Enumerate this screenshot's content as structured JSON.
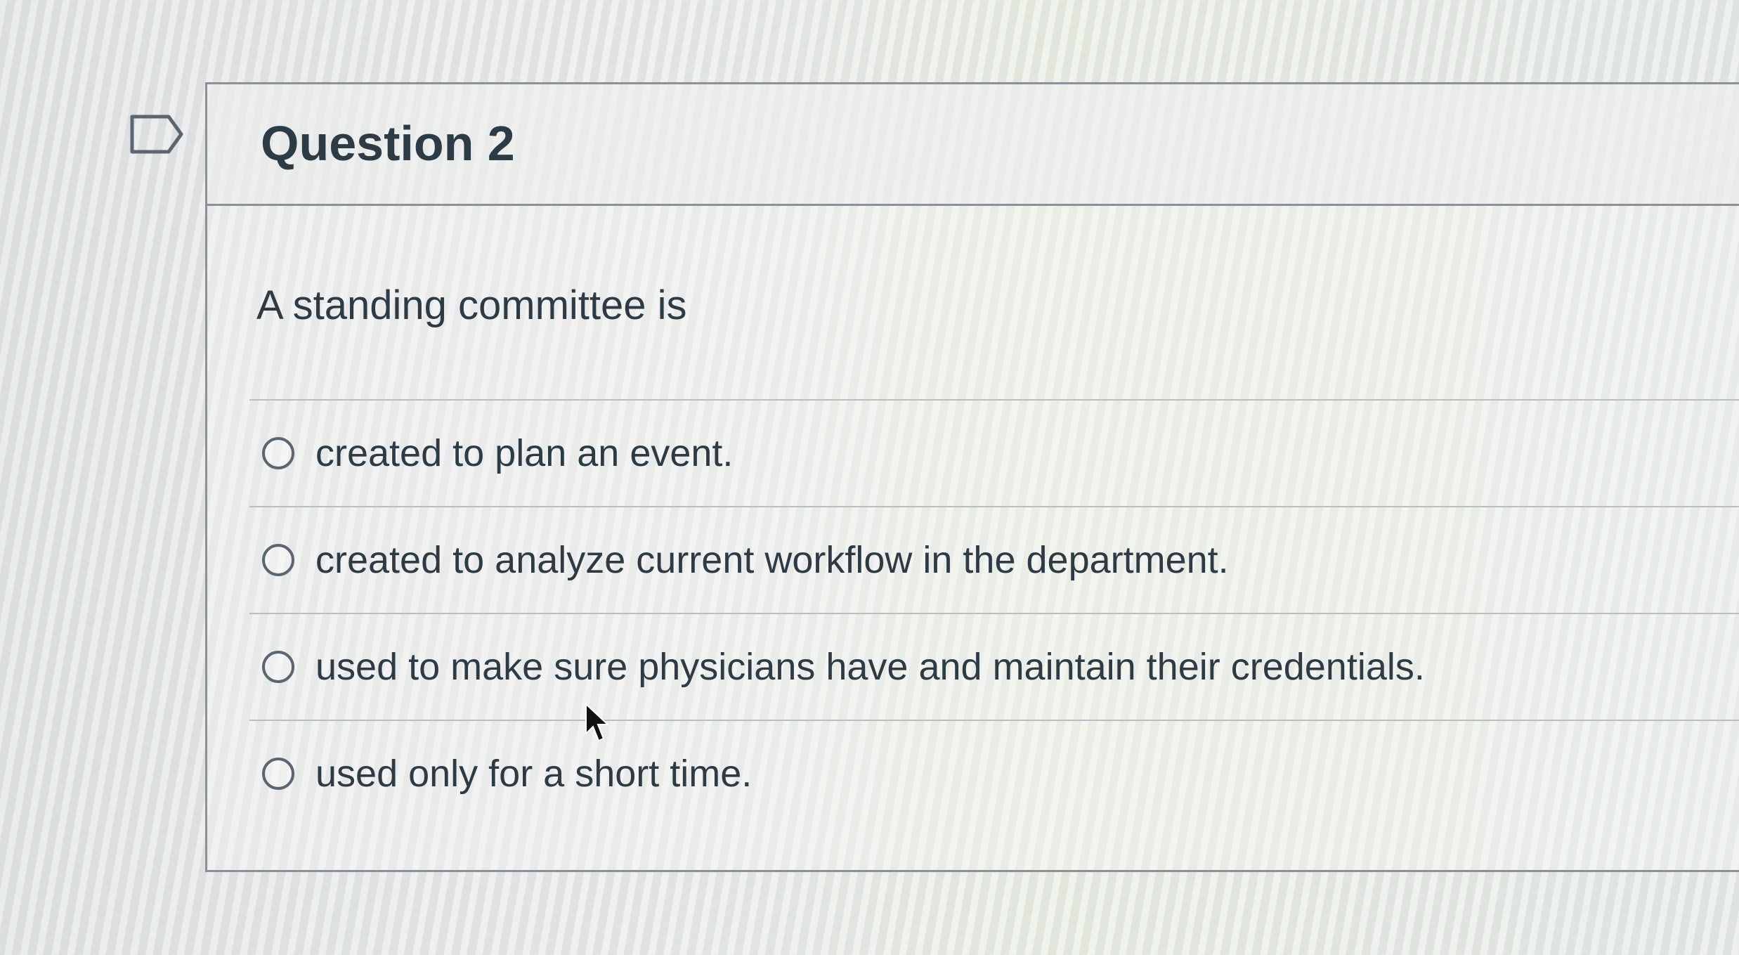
{
  "question": {
    "title": "Question 2",
    "text": "A standing committee is",
    "flag_icon": "flag-outline-icon"
  },
  "answers": [
    {
      "label": "created to plan an event.",
      "selected": false
    },
    {
      "label": "created to analyze current workflow in the department.",
      "selected": false
    },
    {
      "label": "used to make sure physicians have and maintain their credentials.",
      "selected": false
    },
    {
      "label": "used only for a short time.",
      "selected": false
    }
  ],
  "colors": {
    "text": "#2d3b45",
    "border": "#8b9196",
    "divider": "#b9bec2"
  }
}
